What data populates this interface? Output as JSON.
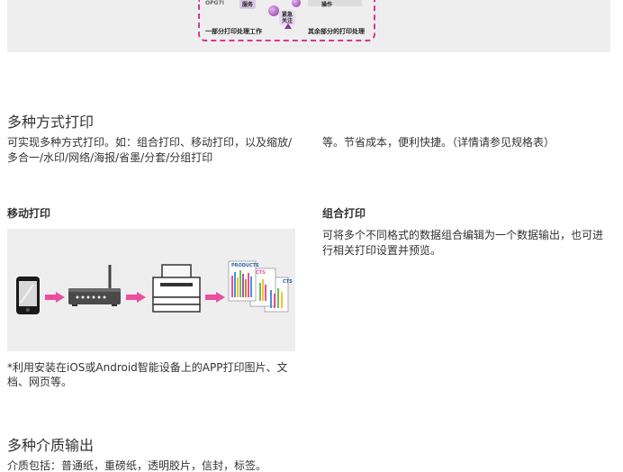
{
  "banner": {
    "label_left": "一部分打印处理工作",
    "label_right": "其余部分的打印处理",
    "tag_top": "服务",
    "tag_mid": "紧急\n关注",
    "tag_top_right": "操作",
    "partial_word": "OPG7I"
  },
  "sections": {
    "multi_print": {
      "title": "多种方式打印",
      "desc_left": "可实现多种方式打印。如：组合打印、移动打印，以及缩放/多合一/水印/网络/海报/省墨/分套/分组打印",
      "desc_right": "等。节省成本，便利快捷。（详情请参见规格表）"
    },
    "mobile_print": {
      "title": "移动打印",
      "note": "*利用安装在iOS或Android智能设备上的APP打印图片、文档、网页等。"
    },
    "combo_print": {
      "title": "组合打印",
      "desc": "可将多个不同格式的数据组合编辑为一个数据输出，也可进行相关打印设置并预览。"
    },
    "media": {
      "title": "多种介质输出",
      "desc": "介质包括：普通纸，重磅纸，透明胶片，信封，标签。"
    }
  },
  "figure": {
    "doc_label_1": "PRODUCTS",
    "doc_label_2": "CTS",
    "doc_label_3": "CTS"
  },
  "colors": {
    "accent": "#e94f9b",
    "banner_border": "#d63a86",
    "panel_bg": "#eeeeee",
    "text": "#333333"
  }
}
